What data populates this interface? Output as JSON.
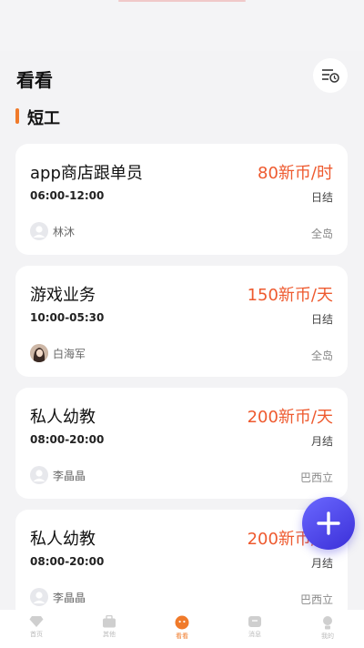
{
  "header": {
    "title": "看看"
  },
  "section": {
    "title": "短工"
  },
  "jobs": [
    {
      "title": "app商店跟单员",
      "pay": "80新币/时",
      "time": "06:00-12:00",
      "settle": "日结",
      "poster": "林沐",
      "location": "全岛"
    },
    {
      "title": "游戏业务",
      "pay": "150新币/天",
      "time": "10:00-05:30",
      "settle": "日结",
      "poster": "白海军",
      "location": "全岛"
    },
    {
      "title": "私人幼教",
      "pay": "200新币/天",
      "time": "08:00-20:00",
      "settle": "月结",
      "poster": "李晶晶",
      "location": "巴西立"
    },
    {
      "title": "私人幼教",
      "pay": "200新币/天",
      "time": "08:00-20:00",
      "settle": "月结",
      "poster": "李晶晶",
      "location": "巴西立"
    }
  ],
  "tabs": [
    {
      "label": "首页",
      "icon": "diamond-icon"
    },
    {
      "label": "其他",
      "icon": "briefcase-icon"
    },
    {
      "label": "看看",
      "icon": "face-icon"
    },
    {
      "label": "消息",
      "icon": "message-icon"
    },
    {
      "label": "我的",
      "icon": "profile-icon"
    }
  ],
  "colors": {
    "accent": "#f07a2a",
    "pay": "#ee5a2f",
    "fab": "#4b3fe6"
  }
}
